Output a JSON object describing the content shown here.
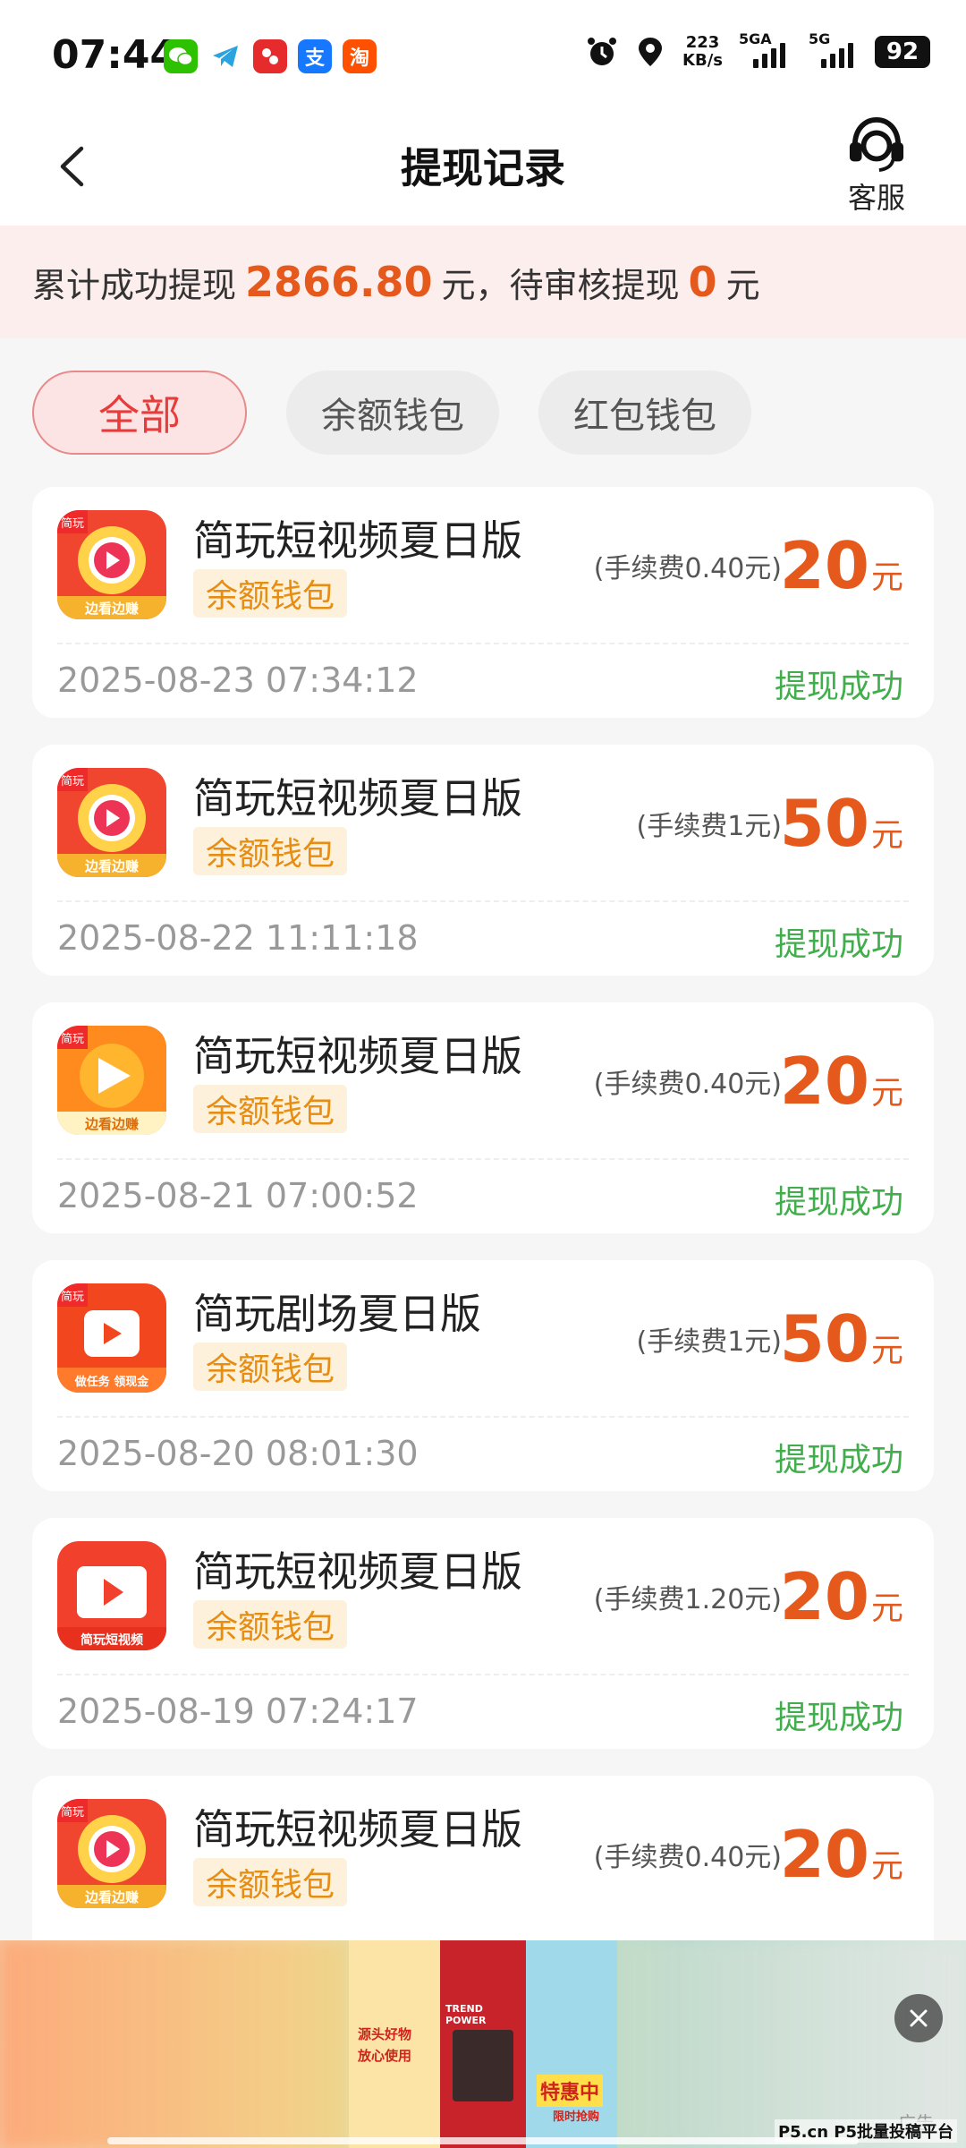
{
  "status_bar": {
    "time": "07:44",
    "net_speed_value": "223",
    "net_speed_unit": "KB/s",
    "signal1_label": "5GA",
    "signal2_label": "5G",
    "battery": "92",
    "notification_apps": [
      "wechat-icon",
      "telegram-icon",
      "game-icon",
      "alipay-icon",
      "taobao-icon"
    ],
    "alipay_glyph": "支",
    "taobao_glyph": "淘"
  },
  "header": {
    "title": "提现记录",
    "service_label": "客服"
  },
  "summary": {
    "prefix": "累计成功提现",
    "total": "2866.80",
    "mid": "元，待审核提现",
    "pending": "0",
    "suffix": "元"
  },
  "tabs": [
    {
      "label": "全部",
      "active": true
    },
    {
      "label": "余额钱包",
      "active": false
    },
    {
      "label": "红包钱包",
      "active": false
    }
  ],
  "records": [
    {
      "app": "简玩短视频夏日版",
      "tag": "余额钱包",
      "fee": "(手续费0.40元)",
      "amount": "20",
      "unit": "元",
      "date": "2025-08-23 07:34:12",
      "status": "提现成功",
      "icon_caption": "边看边赚",
      "icon_badge": "简玩"
    },
    {
      "app": "简玩短视频夏日版",
      "tag": "余额钱包",
      "fee": "(手续费1元)",
      "amount": "50",
      "unit": "元",
      "date": "2025-08-22 11:11:18",
      "status": "提现成功",
      "icon_caption": "边看边赚",
      "icon_badge": "简玩"
    },
    {
      "app": "简玩短视频夏日版",
      "tag": "余额钱包",
      "fee": "(手续费0.40元)",
      "amount": "20",
      "unit": "元",
      "date": "2025-08-21 07:00:52",
      "status": "提现成功",
      "icon_caption": "边看边赚",
      "icon_badge": "简玩"
    },
    {
      "app": "简玩剧场夏日版",
      "tag": "余额钱包",
      "fee": "(手续费1元)",
      "amount": "50",
      "unit": "元",
      "date": "2025-08-20 08:01:30",
      "status": "提现成功",
      "icon_caption": "做任务 领现金",
      "icon_badge": "简玩"
    },
    {
      "app": "简玩短视频夏日版",
      "tag": "余额钱包",
      "fee": "(手续费1.20元)",
      "amount": "20",
      "unit": "元",
      "date": "2025-08-19 07:24:17",
      "status": "提现成功",
      "icon_caption": "简玩短视频",
      "icon_badge": ""
    },
    {
      "app": "简玩短视频夏日版",
      "tag": "余额钱包",
      "fee": "(手续费0.40元)",
      "amount": "20",
      "unit": "元",
      "date": "",
      "status": "",
      "icon_caption": "边看边赚",
      "icon_badge": "简玩"
    }
  ],
  "ad": {
    "creative_texts": [
      "源头好物",
      "放心使用",
      "特惠中",
      "限时抢购",
      "TREND POWER"
    ],
    "label": "广告"
  },
  "watermark": "P5.cn P5批量投稿平台",
  "colors": {
    "accent": "#e55a1c",
    "success": "#3fae4b",
    "tag_text": "#e68d12",
    "tag_bg": "#fdf1dc",
    "banner_bg": "#fdeeee",
    "active_tab": "#e73c3c"
  }
}
